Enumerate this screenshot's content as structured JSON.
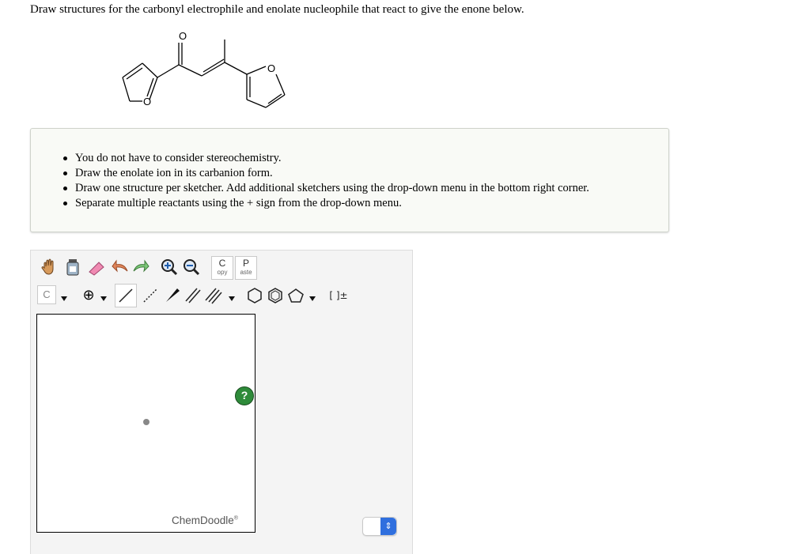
{
  "question": "Draw structures for the carbonyl electrophile and enolate nucleophile that react to give the enone below.",
  "molecule": {
    "carbonyl_atom": "O",
    "furan_left_atom": "O",
    "furan_right_atom": "O"
  },
  "hints": [
    "You do not have to consider stereochemistry.",
    "Draw the enolate ion in its carbanion form.",
    "Draw one structure per sketcher. Add additional sketchers using the drop-down menu in the bottom right corner.",
    "Separate multiple reactants using the + sign from the drop-down menu."
  ],
  "toolbar": {
    "copy_big": "C",
    "copy_small": "opy",
    "paste_big": "P",
    "paste_small": "aste",
    "atom_label": "C",
    "charge_label": "⊕",
    "bracket_label": "[ ]±"
  },
  "sketcher": {
    "help_label": "?",
    "brand": "ChemDoodle",
    "brand_mark": "®"
  },
  "sketch_select": {
    "arrow": "⇕"
  }
}
